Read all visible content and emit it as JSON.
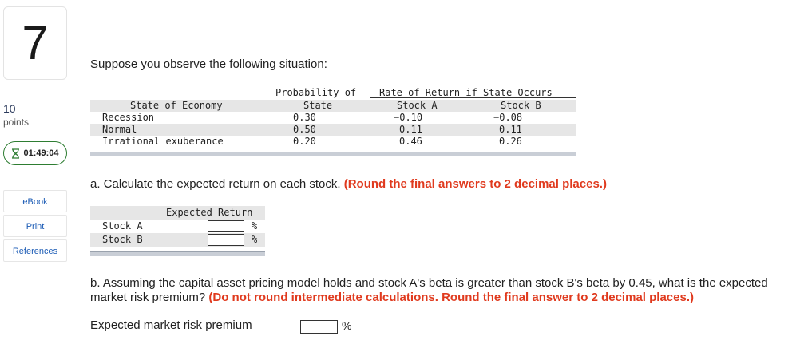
{
  "question": {
    "number": "7",
    "points_value": "10",
    "points_label": "points"
  },
  "timer": {
    "text": "01:49:04",
    "icon": "hourglass-icon",
    "color": "#2e7d32"
  },
  "side_links": [
    "eBook",
    "Print",
    "References"
  ],
  "intro": "Suppose you observe the following situation:",
  "table1": {
    "header_top": [
      "Probability of",
      "Rate of Return if State Occurs"
    ],
    "header_bottom": [
      "State of Economy",
      "State",
      "Stock A",
      "Stock B"
    ],
    "rows": [
      [
        "Recession",
        "0.30",
        "−0.10",
        "−0.08"
      ],
      [
        "Normal",
        "0.50",
        "0.11",
        "0.11"
      ],
      [
        "Irrational exuberance",
        "0.20",
        "0.46",
        "0.26"
      ]
    ]
  },
  "part_a": {
    "text": "a. Calculate the expected return on each stock.",
    "instruction": "(Round the final answers to 2 decimal places.)"
  },
  "table2": {
    "header": "Expected Return",
    "rows": [
      {
        "label": "Stock A",
        "value": "",
        "unit": "%"
      },
      {
        "label": "Stock B",
        "value": "",
        "unit": "%"
      }
    ]
  },
  "part_b": {
    "text": "b. Assuming the capital asset pricing model holds and stock A's beta is greater than stock B's beta by 0.45, what is the expected market risk premium?",
    "instruction": "(Do not round intermediate calculations. Round the final answer to 2 decimal places.)"
  },
  "expected_mrp": {
    "label": "Expected market risk premium",
    "value": "",
    "unit": "%"
  },
  "colors": {
    "accent_red": "#e03a1e",
    "link_blue": "#1b5bb5",
    "timer_green": "#2e7d32"
  }
}
